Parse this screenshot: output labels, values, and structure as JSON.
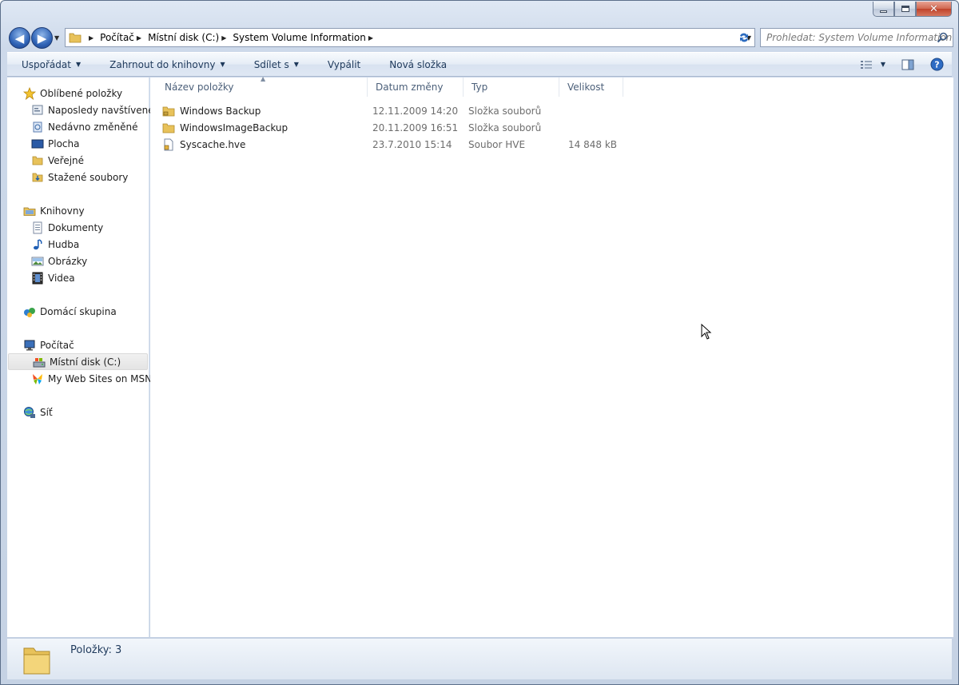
{
  "window": {
    "caption_close": "✕"
  },
  "address_bar": {
    "crumbs": [
      "Počítač",
      "Místní disk (C:)",
      "System Volume Information"
    ]
  },
  "search": {
    "placeholder": "Prohledat: System Volume Information"
  },
  "toolbar": {
    "items": [
      {
        "label": "Uspořádat",
        "dropdown": true
      },
      {
        "label": "Zahrnout do knihovny",
        "dropdown": true
      },
      {
        "label": "Sdílet s",
        "dropdown": true
      },
      {
        "label": "Vypálit",
        "dropdown": false
      },
      {
        "label": "Nová složka",
        "dropdown": false
      }
    ]
  },
  "nav_pane": {
    "favorites": {
      "label": "Oblíbené položky",
      "items": [
        "Naposledy navštívené",
        "Nedávno změněné",
        "Plocha",
        "Veřejné",
        "Stažené soubory"
      ]
    },
    "libraries": {
      "label": "Knihovny",
      "items": [
        "Dokumenty",
        "Hudba",
        "Obrázky",
        "Videa"
      ]
    },
    "homegroup": {
      "label": "Domácí skupina"
    },
    "computer": {
      "label": "Počítač",
      "items": [
        "Místní disk (C:)",
        "My Web Sites on MSN"
      ]
    },
    "network": {
      "label": "Síť"
    }
  },
  "file_list": {
    "columns": [
      "Název položky",
      "Datum změny",
      "Typ",
      "Velikost"
    ],
    "rows": [
      {
        "name": "Windows Backup",
        "date": "12.11.2009 14:20",
        "type": "Složka souborů",
        "size": "",
        "icon": "locked-folder-icon"
      },
      {
        "name": "WindowsImageBackup",
        "date": "20.11.2009 16:51",
        "type": "Složka souborů",
        "size": "",
        "icon": "folder-icon"
      },
      {
        "name": "Syscache.hve",
        "date": "23.7.2010 15:14",
        "type": "Soubor HVE",
        "size": "14 848 kB",
        "icon": "locked-file-icon"
      }
    ]
  },
  "status_bar": {
    "item_count": "Položky: 3"
  },
  "colors": {
    "toolbar_text": "#1e395b",
    "column_header_text": "#4c607a",
    "meta_text": "#6d6d6d",
    "folder_yellow": "#e8c25a"
  }
}
